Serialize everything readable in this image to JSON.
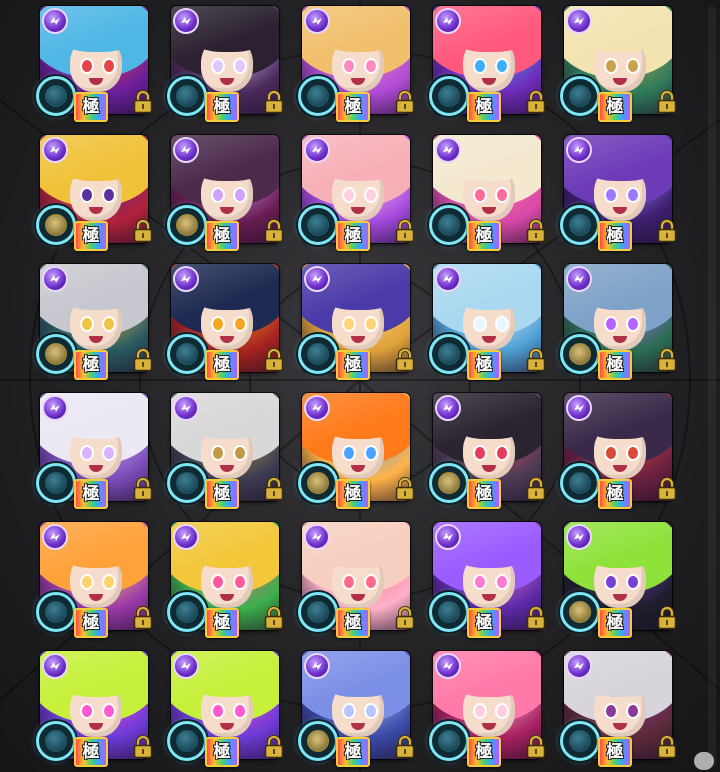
{
  "grid": {
    "badge_text": "極",
    "colors": {
      "wood_element": "#7a3fd6",
      "gauge_ring": "#7fe6f5",
      "badge_border": "#f5cd3b",
      "lock": "#d8b23a"
    },
    "characters": [
      {
        "hair": "#4fb7e6",
        "bg": "#6b1f9b",
        "accent": "#e8434b",
        "gauge": "blue"
      },
      {
        "hair": "#2b2130",
        "bg": "#4b2a5c",
        "accent": "#e0c7ff",
        "gauge": "blue"
      },
      {
        "hair": "#f2c06d",
        "bg": "#b04bd6",
        "accent": "#ff8ac0",
        "gauge": "blue"
      },
      {
        "hair": "#ff5a7e",
        "bg": "#6f2bb9",
        "accent": "#3bb0ff",
        "gauge": "blue"
      },
      {
        "hair": "#f3e3b0",
        "bg": "#2f7c5a",
        "accent": "#caa24b",
        "gauge": "blue"
      },
      {
        "hair": "#f0c23a",
        "bg": "#b2213a",
        "accent": "#5a2f9e",
        "gauge": "gold"
      },
      {
        "hair": "#4b2a4c",
        "bg": "#6a1d52",
        "accent": "#cfa2ff",
        "gauge": "gold"
      },
      {
        "hair": "#f7b0b8",
        "bg": "#a64ae0",
        "accent": "#ffd1e0",
        "gauge": "blue"
      },
      {
        "hair": "#f4e8cf",
        "bg": "#d94aa9",
        "accent": "#ff6b9b",
        "gauge": "blue"
      },
      {
        "hair": "#6d3bb8",
        "bg": "#3c1f6e",
        "accent": "#9b7aff",
        "gauge": "blue"
      },
      {
        "hair": "#c7c7cf",
        "bg": "#2a5a62",
        "accent": "#f2c446",
        "gauge": "gold"
      },
      {
        "hair": "#1f2a52",
        "bg": "#a8231f",
        "accent": "#f4a623",
        "gauge": "blue"
      },
      {
        "hair": "#4a3ba8",
        "bg": "#e0a23a",
        "accent": "#ffd47a",
        "gauge": "blue"
      },
      {
        "hair": "#a9d8f0",
        "bg": "#4fa0d4",
        "accent": "#e8f6ff",
        "gauge": "blue"
      },
      {
        "hair": "#7fa3c8",
        "bg": "#2c6e55",
        "accent": "#b562ff",
        "gauge": "gold"
      },
      {
        "hair": "#ece8f4",
        "bg": "#7a4bb8",
        "accent": "#d9b3ff",
        "gauge": "blue"
      },
      {
        "hair": "#d8d8d8",
        "bg": "#3e3c52",
        "accent": "#c19a45",
        "gauge": "blue"
      },
      {
        "hair": "#ff7a1a",
        "bg": "#ffb347",
        "accent": "#4aa3ff",
        "gauge": "gold"
      },
      {
        "hair": "#2a2330",
        "bg": "#4c3c55",
        "accent": "#e63d5e",
        "gauge": "gold"
      },
      {
        "hair": "#3a2a4a",
        "bg": "#6b2040",
        "accent": "#d94a3a",
        "gauge": "blue"
      },
      {
        "hair": "#ffa23a",
        "bg": "#9b3aa8",
        "accent": "#ffd36b",
        "gauge": "blue"
      },
      {
        "hair": "#f3c739",
        "bg": "#3bb04a",
        "accent": "#ff5a9a",
        "gauge": "blue"
      },
      {
        "hair": "#f7cfc0",
        "bg": "#ffb0c8",
        "accent": "#ff6a8a",
        "gauge": "blue"
      },
      {
        "hair": "#9b5cff",
        "bg": "#5d2aa8",
        "accent": "#ff7ad2",
        "gauge": "blue"
      },
      {
        "hair": "#8fe23a",
        "bg": "#1f1e2a",
        "accent": "#7a3fd6",
        "gauge": "gold"
      },
      {
        "hair": "#c6f03a",
        "bg": "#6d3ad6",
        "accent": "#ff5ad2",
        "gauge": "blue"
      },
      {
        "hair": "#c6f03a",
        "bg": "#6d3ad6",
        "accent": "#ff5ad2",
        "gauge": "blue"
      },
      {
        "hair": "#7c8fe6",
        "bg": "#3a4aa8",
        "accent": "#b5c6ff",
        "gauge": "gold"
      },
      {
        "hair": "#ff7aa8",
        "bg": "#a82060",
        "accent": "#ffcfe0",
        "gauge": "blue"
      },
      {
        "hair": "#d8d4dc",
        "bg": "#5c2a3a",
        "accent": "#8b3a9b",
        "gauge": "blue"
      }
    ]
  }
}
